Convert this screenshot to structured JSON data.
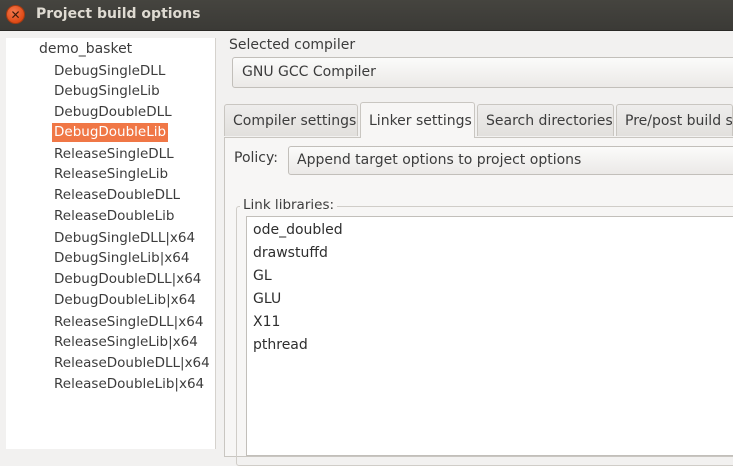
{
  "window": {
    "title": "Project build options"
  },
  "tree": {
    "root": "demo_basket",
    "items": [
      "DebugSingleDLL",
      "DebugSingleLib",
      "DebugDoubleDLL",
      "DebugDoubleLib",
      "ReleaseSingleDLL",
      "ReleaseSingleLib",
      "ReleaseDoubleDLL",
      "ReleaseDoubleLib",
      "DebugSingleDLL|x64",
      "DebugSingleLib|x64",
      "DebugDoubleDLL|x64",
      "DebugDoubleLib|x64",
      "ReleaseSingleDLL|x64",
      "ReleaseSingleLib|x64",
      "ReleaseDoubleDLL|x64",
      "ReleaseDoubleLib|x64"
    ],
    "selected": "DebugDoubleLib"
  },
  "compiler": {
    "label": "Selected compiler",
    "value": "GNU GCC Compiler"
  },
  "tabs": [
    {
      "label": "Compiler settings"
    },
    {
      "label": "Linker settings"
    },
    {
      "label": "Search directories"
    },
    {
      "label": "Pre/post build st"
    }
  ],
  "active_tab": "Linker settings",
  "policy": {
    "label": "Policy:",
    "value": "Append target options to project options"
  },
  "link_libraries": {
    "label": "Link libraries:",
    "items": [
      "ode_doubled",
      "drawstuffd",
      "GL",
      "GLU",
      "X11",
      "pthread"
    ]
  },
  "colors": {
    "selection": "#f07746",
    "titlebar": "#3c3b37",
    "close_button": "#e8552a"
  }
}
